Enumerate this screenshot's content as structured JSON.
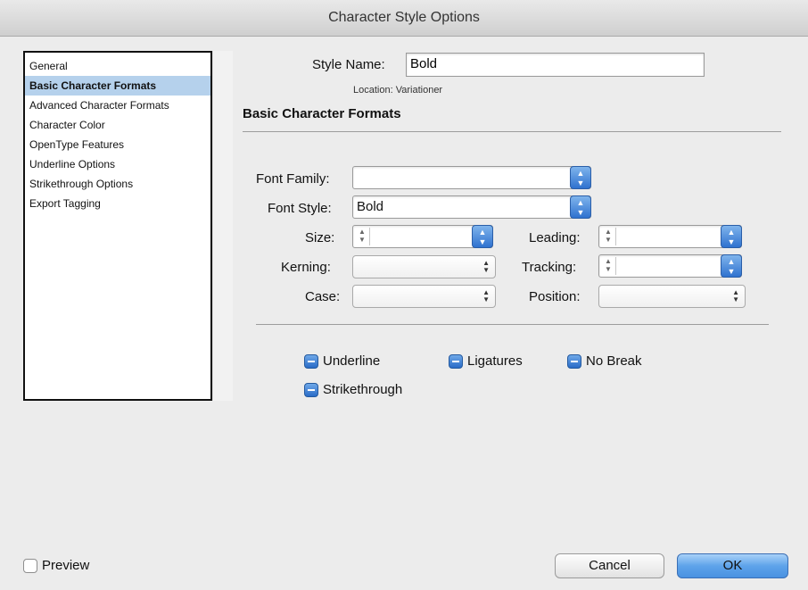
{
  "window": {
    "title": "Character Style Options"
  },
  "sidebar": {
    "items": [
      {
        "label": "General",
        "selected": false
      },
      {
        "label": "Basic Character Formats",
        "selected": true
      },
      {
        "label": "Advanced Character Formats",
        "selected": false
      },
      {
        "label": "Character Color",
        "selected": false
      },
      {
        "label": "OpenType Features",
        "selected": false
      },
      {
        "label": "Underline Options",
        "selected": false
      },
      {
        "label": "Strikethrough Options",
        "selected": false
      },
      {
        "label": "Export Tagging",
        "selected": false
      }
    ]
  },
  "style": {
    "name_label": "Style Name:",
    "name_value": "Bold",
    "location_label": "Location:",
    "location_value": "Variationer"
  },
  "section": {
    "title": "Basic Character Formats"
  },
  "form": {
    "font_family_label": "Font Family:",
    "font_family_value": "",
    "font_style_label": "Font Style:",
    "font_style_value": "Bold",
    "size_label": "Size:",
    "size_value": "",
    "leading_label": "Leading:",
    "leading_value": "",
    "kerning_label": "Kerning:",
    "kerning_value": "",
    "tracking_label": "Tracking:",
    "tracking_value": "",
    "case_label": "Case:",
    "case_value": "",
    "position_label": "Position:",
    "position_value": ""
  },
  "checkboxes": {
    "underline": "Underline",
    "ligatures": "Ligatures",
    "no_break": "No Break",
    "strikethrough": "Strikethrough"
  },
  "footer": {
    "preview_label": "Preview",
    "cancel_label": "Cancel",
    "ok_label": "OK"
  },
  "colors": {
    "selection": "#b5d1ec",
    "accent": "#4a92e1"
  }
}
